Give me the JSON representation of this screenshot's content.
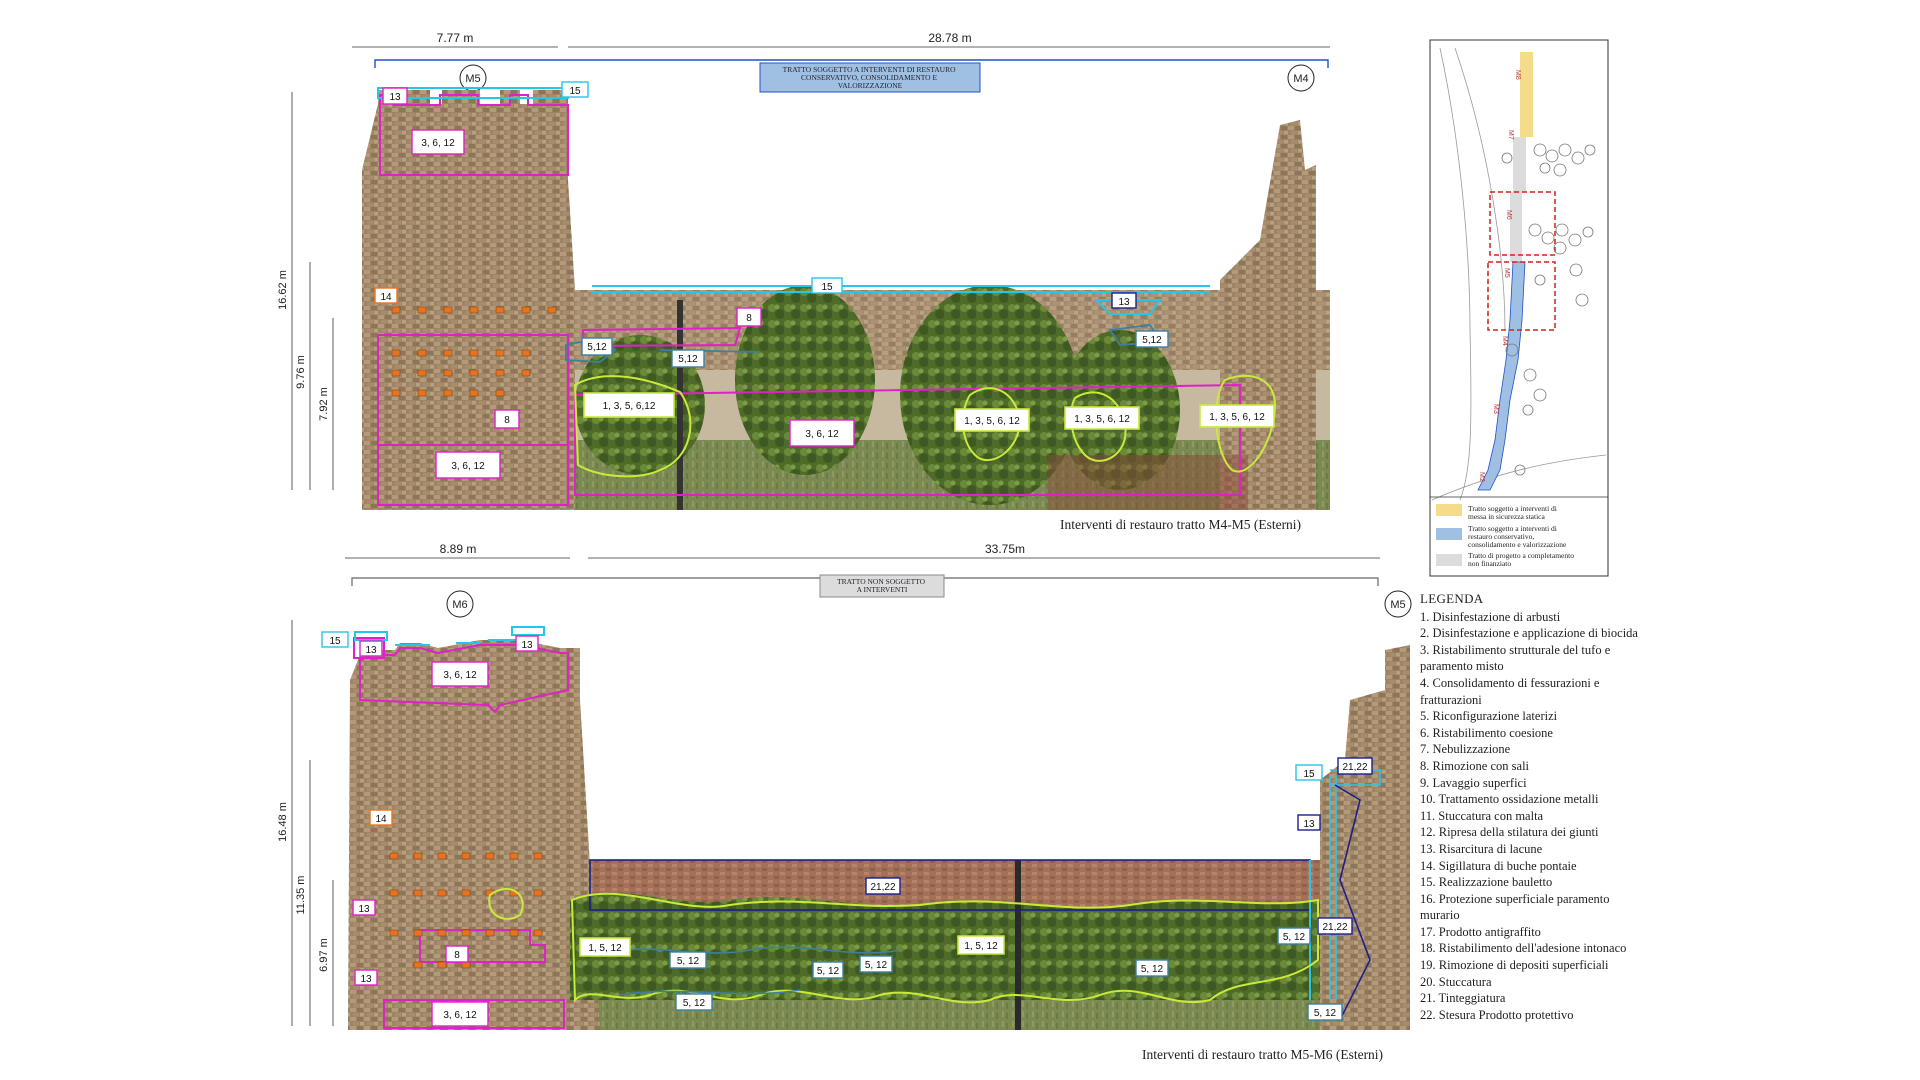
{
  "colors": {
    "magenta": "#e020c8",
    "orange": "#e8731e",
    "cyan": "#26c6e8",
    "lime": "#c9ea3a",
    "navy": "#1b1f8c",
    "teal": "#3d7fa0",
    "blue_band": "#9fc0e2",
    "grey_band": "#dcdcdc",
    "yellow_band": "#f5dc8a",
    "red_dash": "#d42020"
  },
  "top": {
    "dim_left": "7.77 m",
    "dim_right": "28.78 m",
    "marker_left": "M5",
    "marker_right": "M4",
    "banner": "TRATTO SOGGETTO A INTERVENTI DI RESTAURO CONSERVATIVO, CONSOLIDAMENTO E VALORIZZAZIONE",
    "height_1": "16.62 m",
    "height_2": "9.76 m",
    "height_3": "7.92 m",
    "caption": "Interventi di restauro tratto M4-M5 (Esterni)",
    "labels": {
      "l13": "13",
      "l15a": "15",
      "l3612a": "3, 6, 12",
      "l14": "14",
      "l8a": "8",
      "l3612b": "3, 6, 12",
      "l15b": "15",
      "l13b": "13",
      "l8b": "8",
      "l512a": "5,12",
      "l512b": "5,12",
      "l512c": "5,12",
      "l135612": "1, 3, 5, 6,12",
      "l3612c": "3, 6, 12",
      "l135612b": "1, 3, 5, 6, 12",
      "l135612c": "1, 3, 5, 6, 12",
      "l135612d": "1, 3, 5, 6, 12"
    }
  },
  "bottom": {
    "dim_left": "8.89 m",
    "dim_right": "33.75m",
    "marker_left": "M6",
    "marker_right": "M5",
    "banner": "TRATTO NON SOGGETTO A INTERVENTI",
    "height_1": "16.48 m",
    "height_2": "11.35 m",
    "height_3": "6.97 m",
    "caption": "Interventi di restauro tratto M5-M6 (Esterni)",
    "labels": {
      "l15": "15",
      "l13a": "13",
      "l13b": "13",
      "l3612a": "3, 6, 12",
      "l14": "14",
      "l13c": "13",
      "l8": "8",
      "l13d": "13",
      "l3612b": "3, 6, 12",
      "l2122a": "21,22",
      "l2122b": "21,22",
      "l15r": "15",
      "l13r": "13",
      "l2122r": "21,22",
      "l1512a": "1, 5, 12",
      "l512a": "5, 12",
      "l512b": "5, 12",
      "l512c": "5, 12",
      "l512d": "5, 12",
      "l1512b": "1, 5, 12",
      "l512e": "5, 12",
      "l512f": "5, 12",
      "l512g": "5, 12"
    }
  },
  "map": {
    "labels": [
      "M8",
      "M7",
      "M6",
      "M5",
      "M4",
      "M3",
      "M2"
    ],
    "legend": [
      {
        "color": "#f5dc8a",
        "text": "Tratto soggetto a interventi di messa in sicurezza statica"
      },
      {
        "color": "#9fc0e2",
        "text": "Tratto soggetto a interventi di restauro conservativo, consolidamento e valorizzazione"
      },
      {
        "color": "#dcdcdc",
        "text": "Tratto di progetto a completamento non finanziato"
      }
    ]
  },
  "legend": {
    "title": "LEGENDA",
    "items": [
      "1. Disinfestazione di arbusti",
      "2. Disinfestazione e applicazione di biocida",
      "3. Ristabilimento strutturale del tufo e paramento misto",
      "4. Consolidamento di fessurazioni e fratturazioni",
      "5. Riconfigurazione laterizi",
      "6. Ristabilimento coesione",
      "7. Nebulizzazione",
      "8. Rimozione con sali",
      "9. Lavaggio superfici",
      "10. Trattamento ossidazione metalli",
      "11. Stuccatura con malta",
      "12. Ripresa della stilatura dei giunti",
      "13. Risarcitura di lacune",
      "14. Sigillatura di buche pontaie",
      "15. Realizzazione bauletto",
      "16. Protezione superficiale paramento murario",
      "17. Prodotto antigraffito",
      "18. Ristabilimento dell'adesione intonaco",
      "19.  Rimozione di depositi superficiali",
      "20. Stuccatura",
      "21. Tinteggiatura",
      "22. Stesura Prodotto protettivo"
    ]
  }
}
